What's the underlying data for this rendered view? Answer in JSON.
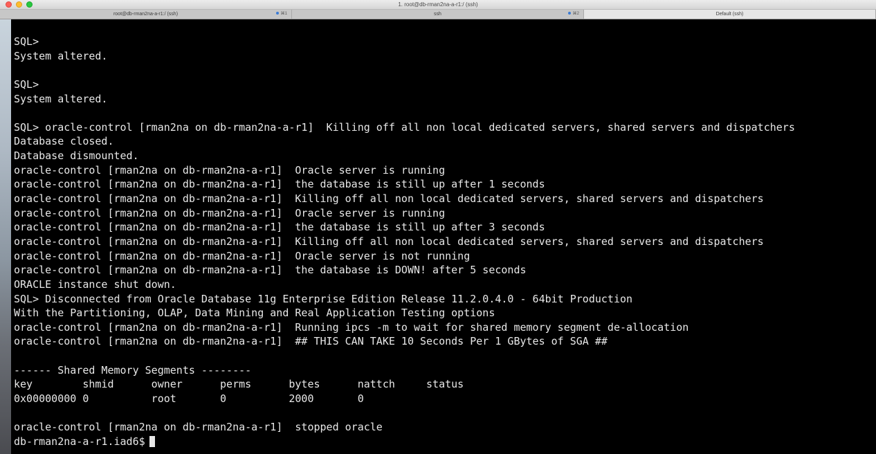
{
  "window": {
    "title": "1. root@db-rman2na-a-r1:/ (ssh)",
    "tabs": [
      {
        "label": "root@db-rman2na-a-r1:/ (ssh)",
        "shortcut": "⌘1",
        "active": false
      },
      {
        "label": "ssh",
        "shortcut": "⌘2",
        "active": false
      },
      {
        "label": "Default (ssh)",
        "shortcut": "",
        "active": true
      }
    ]
  },
  "terminal": {
    "lines": [
      "SQL>",
      "System altered.",
      "",
      "SQL>",
      "System altered.",
      "",
      "SQL> oracle-control [rman2na on db-rman2na-a-r1]  Killing off all non local dedicated servers, shared servers and dispatchers",
      "Database closed.",
      "Database dismounted.",
      "oracle-control [rman2na on db-rman2na-a-r1]  Oracle server is running",
      "oracle-control [rman2na on db-rman2na-a-r1]  the database is still up after 1 seconds",
      "oracle-control [rman2na on db-rman2na-a-r1]  Killing off all non local dedicated servers, shared servers and dispatchers",
      "oracle-control [rman2na on db-rman2na-a-r1]  Oracle server is running",
      "oracle-control [rman2na on db-rman2na-a-r1]  the database is still up after 3 seconds",
      "oracle-control [rman2na on db-rman2na-a-r1]  Killing off all non local dedicated servers, shared servers and dispatchers",
      "oracle-control [rman2na on db-rman2na-a-r1]  Oracle server is not running",
      "oracle-control [rman2na on db-rman2na-a-r1]  the database is DOWN! after 5 seconds",
      "ORACLE instance shut down.",
      "SQL> Disconnected from Oracle Database 11g Enterprise Edition Release 11.2.0.4.0 - 64bit Production",
      "With the Partitioning, OLAP, Data Mining and Real Application Testing options",
      "oracle-control [rman2na on db-rman2na-a-r1]  Running ipcs -m to wait for shared memory segment de-allocation",
      "oracle-control [rman2na on db-rman2na-a-r1]  ## THIS CAN TAKE 10 Seconds Per 1 GBytes of SGA ##",
      "",
      "------ Shared Memory Segments --------",
      "key        shmid      owner      perms      bytes      nattch     status",
      "0x00000000 0          root       0          2000       0",
      "",
      "oracle-control [rman2na on db-rman2na-a-r1]  stopped oracle"
    ],
    "prompt": "db-rman2na-a-r1.iad6$"
  }
}
